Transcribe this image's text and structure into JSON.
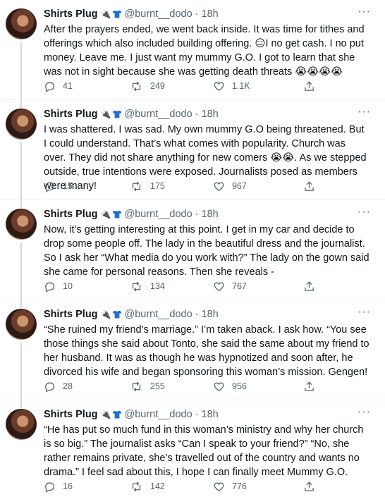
{
  "author": {
    "name": "Shirts Plug",
    "handle": "@burnt__dodo",
    "separator": "·",
    "badges": [
      "🔌",
      "shirt-icon"
    ]
  },
  "tweets": [
    {
      "time": "18h",
      "text": "After the prayers ended, we went back inside. It was time for tithes and offerings which also included building offering. 😑I no get cash. I no put money. Leave me. I just want my mummy G.O. I got to learn that she was not in sight because she was getting death threats 😭😭😭😭",
      "replies": "41",
      "retweets": "249",
      "likes": "1.1K"
    },
    {
      "time": "18h",
      "text": "I was shattered. I was sad. My own mummy G.O being threatened. But I could understand. That’s what comes with popularity. Church was over. They did not share anything for new comers 😭😭. As we stepped outside, true intentions were exposed. Journalists posed as members were many!",
      "replies": "15",
      "retweets": "175",
      "likes": "967"
    },
    {
      "time": "18h",
      "text": "Now, it’s getting interesting at this point. I get in my car and decide to drop some people off. The lady in the beautiful dress and the journalist. So I ask her “What media do you work with?” The lady on the gown said she came for personal reasons. Then she reveals -",
      "replies": "10",
      "retweets": "134",
      "likes": "767"
    },
    {
      "time": "18h",
      "text": "“She ruined my friend’s marriage.” I’m taken aback. I ask how. “You see those things she said about Tonto, she said the same about my friend to her husband. It was as though he was hypnotized and soon after, he divorced his wife and began sponsoring this woman’s mission. Gengen!",
      "replies": "28",
      "retweets": "255",
      "likes": "956"
    },
    {
      "time": "18h",
      "text": "“He has put so much fund in this woman’s ministry and why her church is so big.” The journalist asks “Can I speak to your friend?” “No, she rather remains private, she’s travelled out of the country and wants no drama.” I feel sad about this, I hope I can finally meet Mummy G.O.",
      "replies": "16",
      "retweets": "142",
      "likes": "776"
    }
  ],
  "more_glyph": "···"
}
